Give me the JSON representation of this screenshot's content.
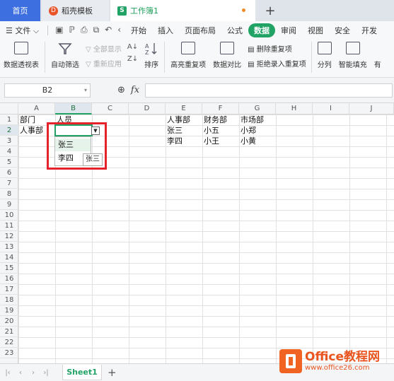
{
  "tabs": {
    "home": "首页",
    "template": "稻壳模板",
    "workbook": "工作簿1",
    "add": "+"
  },
  "menu": {
    "file": "文件",
    "items": [
      "开始",
      "插入",
      "页面布局",
      "公式",
      "数据",
      "审阅",
      "视图",
      "安全",
      "开发"
    ],
    "active": "数据"
  },
  "ribbon": {
    "pivot": "数据透视表",
    "autofilter": "自动筛选",
    "show_all": "全部显示",
    "reapply": "重新应用",
    "sort": "排序",
    "highlight_dup": "高亮重复项",
    "compare": "数据对比",
    "delete_dup": "删除重复项",
    "reject_dup": "拒绝录入重复项",
    "split": "分列",
    "smart_fill": "智能填充",
    "more": "有"
  },
  "formula_bar": {
    "name_box": "B2",
    "fx": "fx",
    "value": ""
  },
  "columns": [
    "A",
    "B",
    "C",
    "D",
    "E",
    "F",
    "G",
    "H",
    "I",
    "J"
  ],
  "selected_column": "B",
  "rows": [
    "1",
    "2",
    "3",
    "4",
    "5",
    "6",
    "7",
    "8",
    "9",
    "10",
    "11",
    "12",
    "13",
    "14",
    "15",
    "16",
    "17",
    "18",
    "19",
    "20",
    "21",
    "22",
    "23"
  ],
  "selected_row": "2",
  "cells": {
    "A1": "部门",
    "B1": "人员",
    "A2": "人事部",
    "E1": "人事部",
    "F1": "财务部",
    "G1": "市场部",
    "E2": "张三",
    "F2": "小五",
    "G2": "小郑",
    "E3": "李四",
    "F3": "小王",
    "G3": "小黄"
  },
  "dropdown": {
    "options": [
      "张三",
      "李四"
    ],
    "highlighted": "张三",
    "tooltip": "张三"
  },
  "sheets": [
    "Sheet1"
  ],
  "watermark": {
    "title": "Office教程网",
    "url": "www.office26.com"
  },
  "colors": {
    "accent": "#21a366",
    "home_tab": "#3d6fe0",
    "highlight_box": "#e5212b",
    "watermark": "#e9541f"
  }
}
